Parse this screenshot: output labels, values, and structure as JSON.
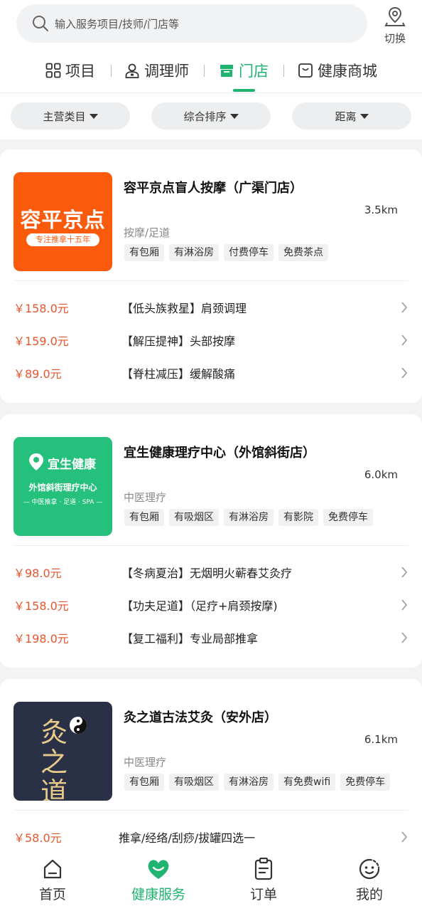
{
  "search": {
    "placeholder": "输入服务项目/技师/门店等",
    "switch_label": "切换"
  },
  "tabs": [
    {
      "label": "项目",
      "icon": "grid-icon"
    },
    {
      "label": "调理师",
      "icon": "person-icon"
    },
    {
      "label": "门店",
      "icon": "store-icon",
      "active": true
    },
    {
      "label": "健康商城",
      "icon": "bag-icon"
    }
  ],
  "filters": [
    {
      "label": "主营类目"
    },
    {
      "label": "综合排序"
    },
    {
      "label": "距离"
    }
  ],
  "stores": [
    {
      "name": "容平京点盲人按摩（广渠门店）",
      "distance": "3.5km",
      "category": "按摩/足道",
      "tags": [
        "有包厢",
        "有淋浴房",
        "付费停车",
        "免费茶点"
      ],
      "logo": {
        "title": "容平京点",
        "subtitle": "专注推拿十五年",
        "bg": "#fa5a0c"
      },
      "services": [
        {
          "price": "￥158.0元",
          "name": "【低头族救星】肩颈调理"
        },
        {
          "price": "￥159.0元",
          "name": "【解压提神】头部按摩"
        },
        {
          "price": "￥89.0元",
          "name": "【脊柱减压】缓解酸痛"
        }
      ]
    },
    {
      "name": "宜生健康理疗中心（外馆斜街店）",
      "distance": "6.0km",
      "category": "中医理疗",
      "tags": [
        "有包厢",
        "有吸烟区",
        "有淋浴房",
        "有影院",
        "免费停车"
      ],
      "logo": {
        "title": "宜生健康",
        "line2": "外馆斜街理疗中心",
        "line3": "— 中医推拿 · 足道 · SPA —",
        "bg": "#24c07c"
      },
      "services": [
        {
          "price": "￥98.0元",
          "name": "【冬病夏治】无烟明火蕲春艾灸疗"
        },
        {
          "price": "￥158.0元",
          "name": "【功夫足道】（足疗+肩颈按摩)"
        },
        {
          "price": "￥198.0元",
          "name": "【复工福利】专业局部推拿"
        }
      ]
    },
    {
      "name": "灸之道古法艾灸（安外店）",
      "distance": "6.1km",
      "category": "中医理疗",
      "tags": [
        "有包厢",
        "有吸烟区",
        "有淋浴房",
        "有免费wifi",
        "免费停车"
      ],
      "logo": {
        "title": "灸之道",
        "bg": "#2a3147"
      },
      "services": [
        {
          "price": "￥58.0元",
          "name": "推拿/经络/刮痧/拔罐四选一"
        }
      ]
    }
  ],
  "bottom_nav": [
    {
      "label": "首页",
      "icon": "home-icon"
    },
    {
      "label": "健康服务",
      "icon": "heart-icon",
      "active": true
    },
    {
      "label": "订单",
      "icon": "clipboard-icon"
    },
    {
      "label": "我的",
      "icon": "smiley-icon"
    }
  ],
  "colors": {
    "accent": "#1fb470",
    "price": "#e4572e"
  }
}
